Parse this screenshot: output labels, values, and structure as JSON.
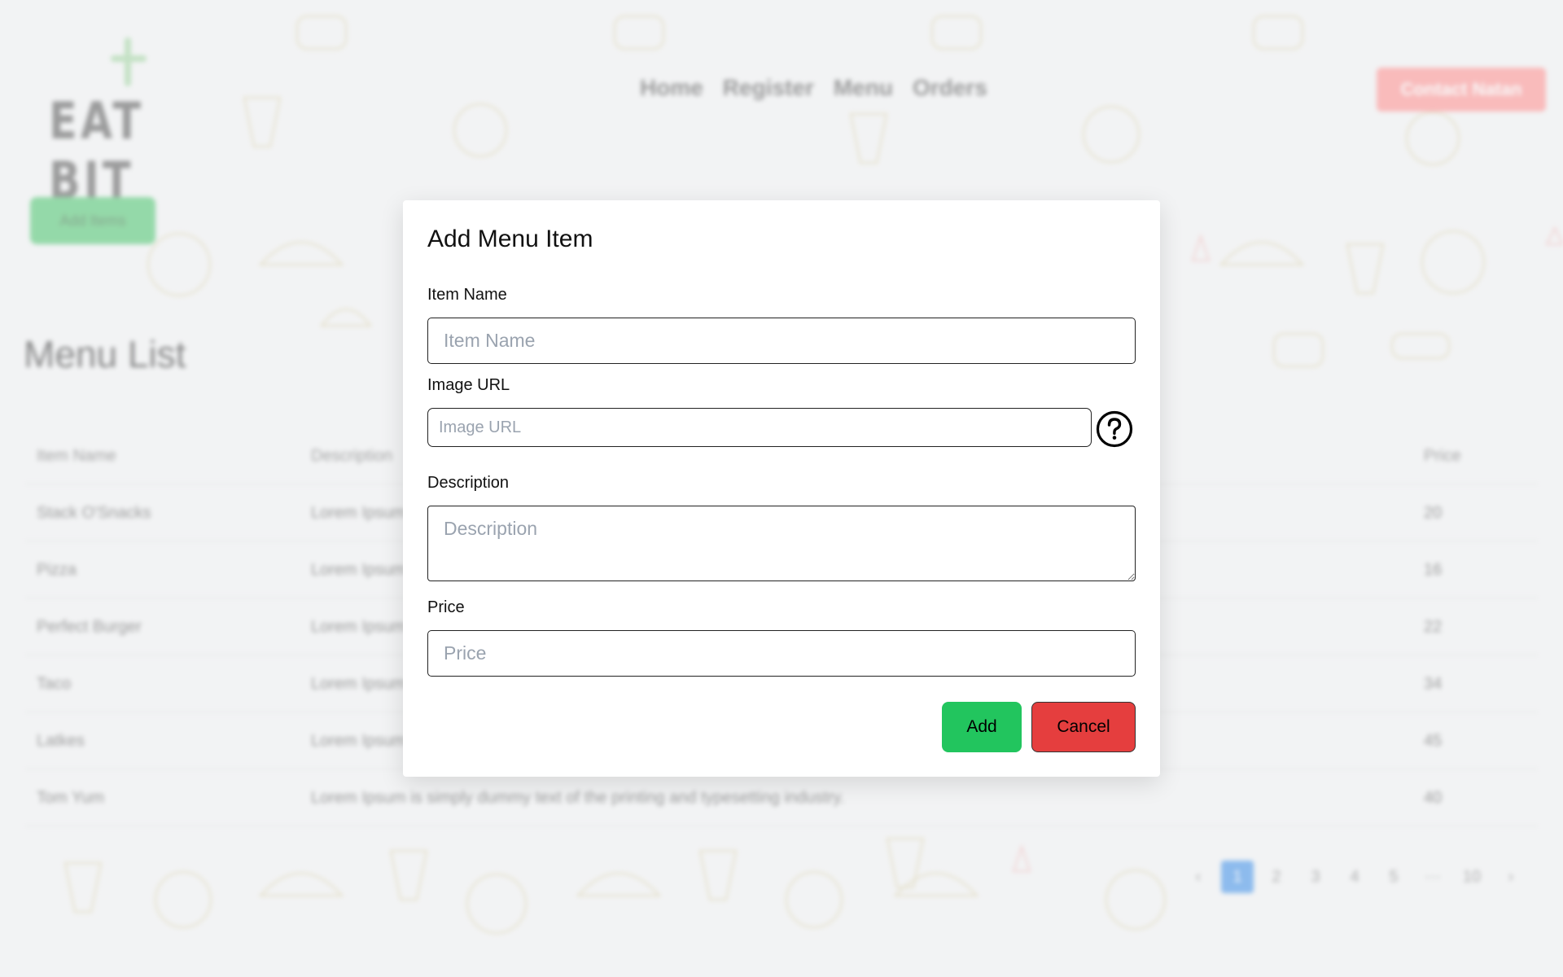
{
  "app": {
    "logo_text": "EAT BIT",
    "nav": [
      "Home",
      "Register",
      "Menu",
      "Orders"
    ],
    "contact_label": "Contact Natan",
    "add_items_label": "Add Items",
    "page_title": "Menu List"
  },
  "table": {
    "headers": {
      "name": "Item Name",
      "description": "Description",
      "price": "Price"
    },
    "rows": [
      {
        "name": "Stack O'Snacks",
        "description": "Lorem Ipsum",
        "price": "20"
      },
      {
        "name": "Pizza",
        "description": "Lorem Ipsum",
        "price": "16"
      },
      {
        "name": "Perfect Burger",
        "description": "Lorem Ipsum",
        "price": "22"
      },
      {
        "name": "Taco",
        "description": "Lorem Ipsum",
        "price": "34"
      },
      {
        "name": "Latkes",
        "description": "Lorem Ipsum",
        "price": "45"
      },
      {
        "name": "Tom Yum",
        "description": "Lorem Ipsum is simply dummy text of the printing and typesetting industry.",
        "price": "40"
      }
    ]
  },
  "pagination": {
    "prev": "‹",
    "pages": [
      "1",
      "2",
      "3",
      "4",
      "5"
    ],
    "ellipsis": "···",
    "last": "10",
    "next": "›",
    "active": "1"
  },
  "modal": {
    "title": "Add Menu Item",
    "item_name": {
      "label": "Item Name",
      "placeholder": "Item Name",
      "value": ""
    },
    "image_url": {
      "label": "Image URL",
      "placeholder": "Image URL",
      "value": "",
      "help_icon": "question-circle-icon"
    },
    "description": {
      "label": "Description",
      "placeholder": "Description",
      "value": ""
    },
    "price": {
      "label": "Price",
      "placeholder": "Price",
      "value": ""
    },
    "add_label": "Add",
    "cancel_label": "Cancel"
  },
  "colors": {
    "add_button": "#22c55e",
    "cancel_button": "#e53e3e",
    "pagination_active": "#3b8ee8",
    "contact_button": "#ff8e8e",
    "add_items_button": "#49c46c"
  }
}
